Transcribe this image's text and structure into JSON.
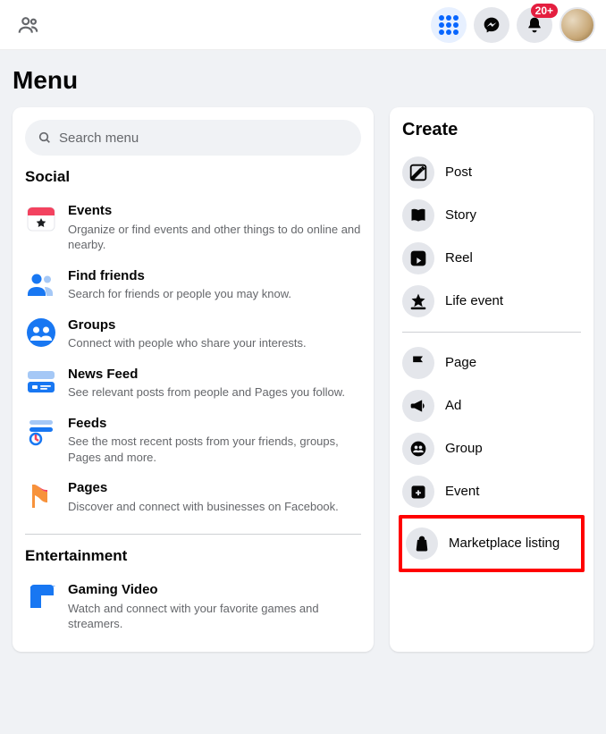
{
  "topnav": {
    "badge": "20+"
  },
  "page": {
    "title": "Menu"
  },
  "search": {
    "placeholder": "Search menu"
  },
  "left": {
    "sections": [
      {
        "title": "Social",
        "items": [
          {
            "name": "Events",
            "desc": "Organize or find events and other things to do online and nearby."
          },
          {
            "name": "Find friends",
            "desc": "Search for friends or people you may know."
          },
          {
            "name": "Groups",
            "desc": "Connect with people who share your interests."
          },
          {
            "name": "News Feed",
            "desc": "See relevant posts from people and Pages you follow."
          },
          {
            "name": "Feeds",
            "desc": "See the most recent posts from your friends, groups, Pages and more."
          },
          {
            "name": "Pages",
            "desc": "Discover and connect with businesses on Facebook."
          }
        ]
      },
      {
        "title": "Entertainment",
        "items": [
          {
            "name": "Gaming Video",
            "desc": "Watch and connect with your favorite games and streamers."
          }
        ]
      }
    ]
  },
  "create": {
    "title": "Create",
    "items1": [
      {
        "label": "Post"
      },
      {
        "label": "Story"
      },
      {
        "label": "Reel"
      },
      {
        "label": "Life event"
      }
    ],
    "items2": [
      {
        "label": "Page"
      },
      {
        "label": "Ad"
      },
      {
        "label": "Group"
      },
      {
        "label": "Event"
      }
    ],
    "highlighted": {
      "label": "Marketplace listing"
    }
  }
}
